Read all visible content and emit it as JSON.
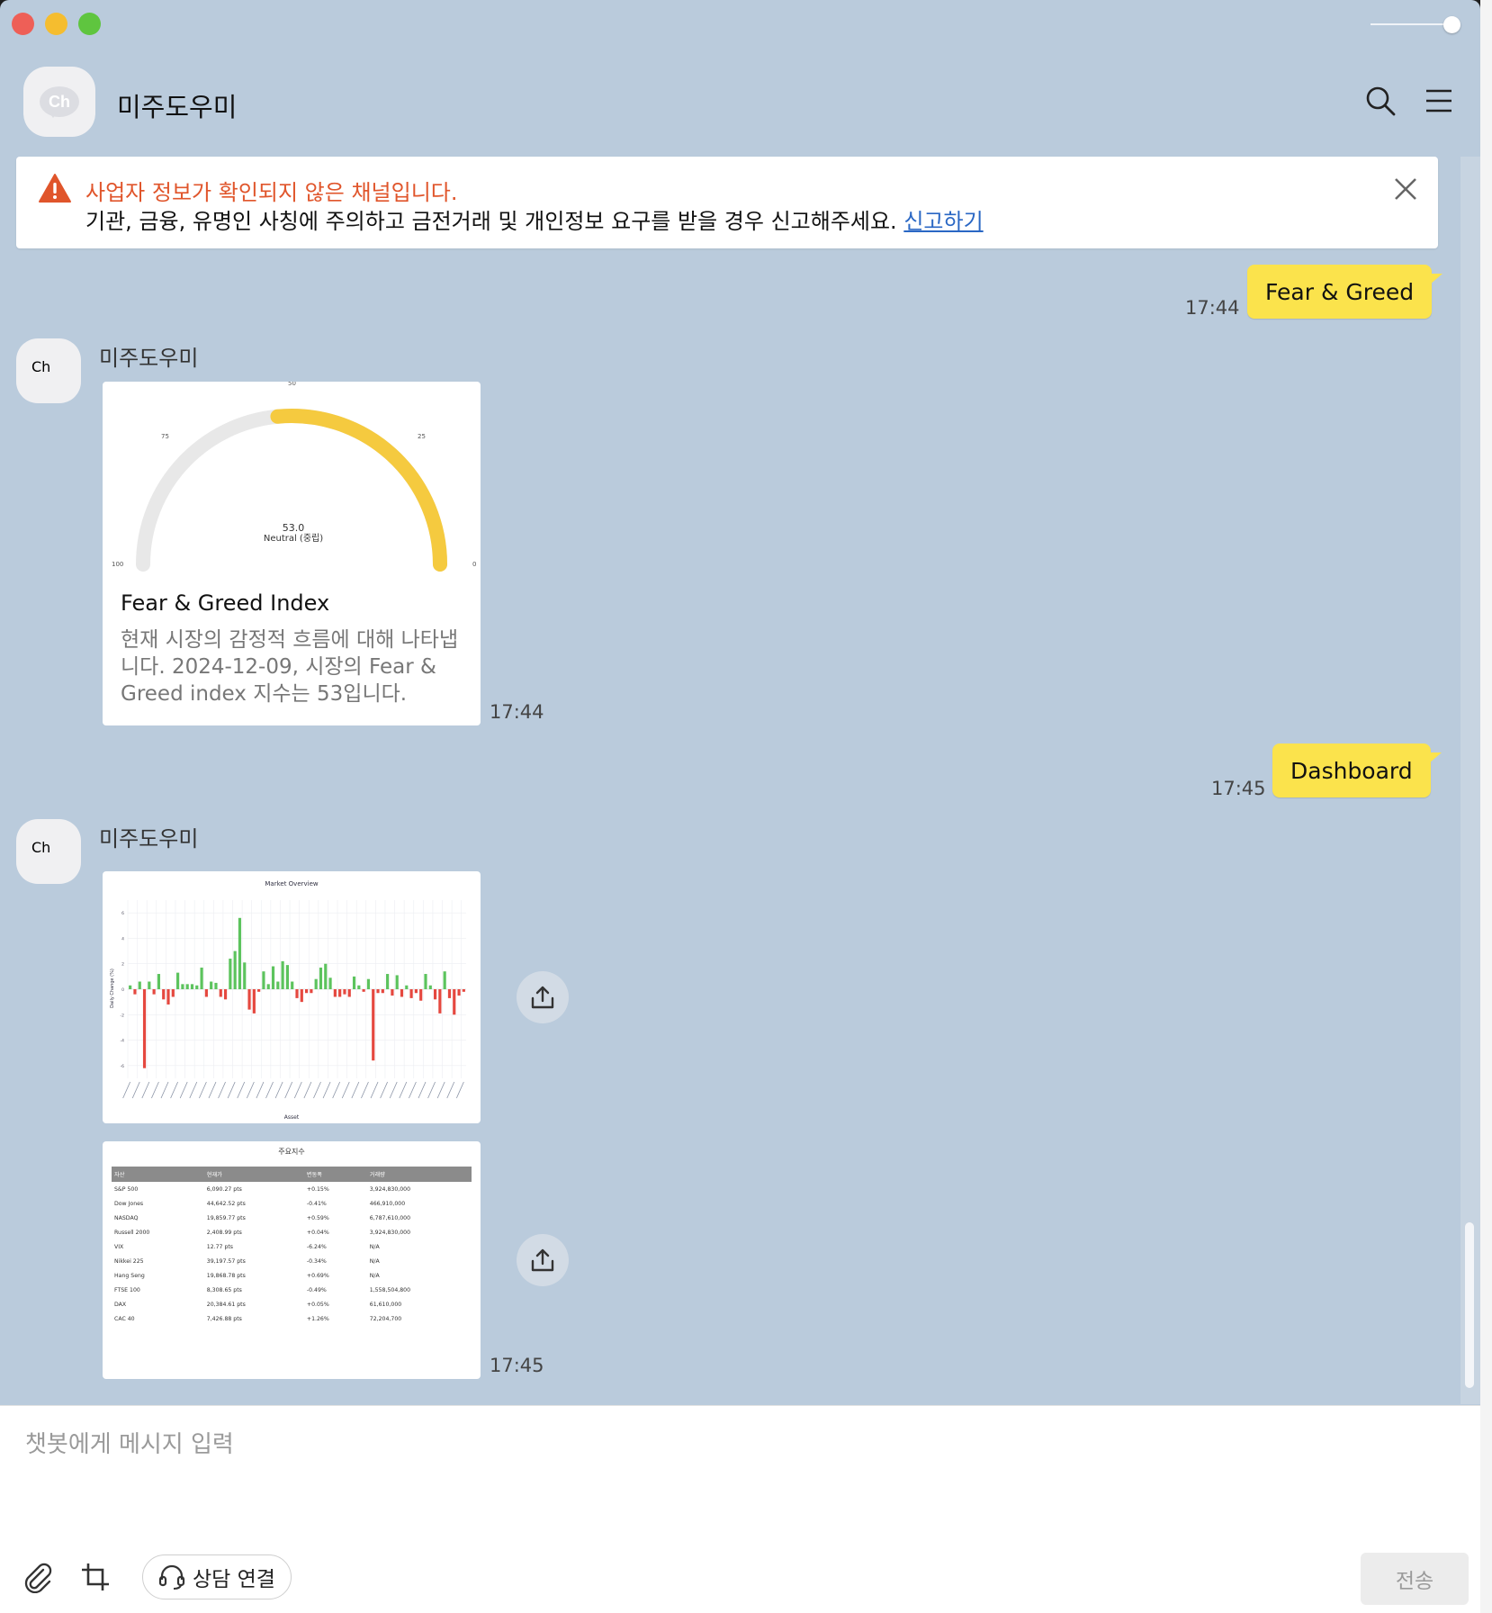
{
  "window": {
    "title": "미주도우미"
  },
  "header": {
    "avatar_text": "Ch",
    "title": "미주도우미",
    "search_icon": "search-icon",
    "menu_icon": "hamburger-menu-icon"
  },
  "notice": {
    "line1": "사업자 정보가 확인되지 않은 채널입니다.",
    "line2": "기관, 금융, 유명인 사칭에 주의하고 금전거래 및 개인정보 요구를 받을 경우 신고해주세요.",
    "report_link": "신고하기"
  },
  "messages": {
    "m1": {
      "text": "Fear & Greed",
      "time": "17:44"
    },
    "b1": {
      "sender": "미주도우미",
      "avatar_text": "Ch",
      "gauge": {
        "value": "53.0",
        "label": "Neutral (중립)",
        "tick_100": "100",
        "tick_75": "75",
        "tick_50": "50",
        "tick_25": "25",
        "tick_0": "0",
        "fraction": 0.47
      },
      "title": "Fear & Greed Index",
      "desc": "현재 시장의 감정적 흐름에 대해 나타냅니다. 2024-12-09, 시장의 Fear & Greed index 지수는 53입니다.",
      "time": "17:44"
    },
    "m2": {
      "text": "Dashboard",
      "time": "17:45"
    },
    "b2": {
      "sender": "미주도우미",
      "avatar_text": "Ch",
      "time": "17:45",
      "table": {
        "title": "주요지수",
        "headers": [
          "자산",
          "현재가",
          "변동폭",
          "거래량"
        ],
        "rows": [
          [
            "S&P 500",
            "6,090.27 pts",
            "+0.15%",
            "3,924,830,000"
          ],
          [
            "Dow Jones",
            "44,642.52 pts",
            "-0.41%",
            "466,910,000"
          ],
          [
            "NASDAQ",
            "19,859.77 pts",
            "+0.59%",
            "6,787,610,000"
          ],
          [
            "Russell 2000",
            "2,408.99 pts",
            "+0.04%",
            "3,924,830,000"
          ],
          [
            "VIX",
            "12.77 pts",
            "-6.24%",
            "N/A"
          ],
          [
            "Nikkei 225",
            "39,197.57 pts",
            "-0.34%",
            "N/A"
          ],
          [
            "Hang Seng",
            "19,868.78 pts",
            "+0.69%",
            "N/A"
          ],
          [
            "FTSE 100",
            "8,308.65 pts",
            "-0.49%",
            "1,558,504,800"
          ],
          [
            "DAX",
            "20,384.61 pts",
            "+0.05%",
            "61,610,000"
          ],
          [
            "CAC 40",
            "7,426.88 pts",
            "+1.26%",
            "72,204,700"
          ]
        ]
      }
    }
  },
  "chart_data": {
    "type": "bar",
    "title": "Market Overview",
    "xlabel": "Asset",
    "ylabel": "Daily Change (%)",
    "yticks": [
      "6",
      "4",
      "2",
      "0",
      "-2",
      "-4",
      "-6"
    ],
    "ylim": [
      -7,
      7
    ],
    "values": [
      0.3,
      -0.4,
      0.6,
      -6.2,
      0.6,
      -0.4,
      1.2,
      -0.8,
      -1.2,
      -0.6,
      1.3,
      0.4,
      0.4,
      0.4,
      0.3,
      1.7,
      -0.6,
      0.6,
      0.5,
      -0.6,
      -0.8,
      2.4,
      3.0,
      5.6,
      2.1,
      -1.6,
      -1.9,
      -0.2,
      1.4,
      0.4,
      1.8,
      0.6,
      2.2,
      1.9,
      0.6,
      -0.7,
      -1.0,
      -0.3,
      -0.3,
      0.8,
      1.7,
      2.0,
      0.9,
      -0.6,
      -0.6,
      -0.4,
      -0.6,
      1.0,
      0.3,
      -0.2,
      0.8,
      -5.6,
      -0.3,
      -0.3,
      1.2,
      -0.5,
      1.1,
      -0.6,
      0.3,
      -0.7,
      -0.3,
      -0.9,
      1.2,
      0.3,
      -0.8,
      -1.9,
      1.4,
      -0.7,
      -2.0,
      -0.5,
      -0.2
    ],
    "colors": {
      "positive": "#5cc35d",
      "negative": "#e5483f"
    }
  },
  "input": {
    "placeholder": "챗봇에게 메시지 입력",
    "consult_label": "상담 연결",
    "send_label": "전송"
  },
  "colors": {
    "chat_bg": "#bacbdc",
    "my_bubble": "#fbe34c",
    "warning": "#e0552b",
    "gauge_fill": "#f5ca3f",
    "gauge_track": "#e8e8e8"
  }
}
